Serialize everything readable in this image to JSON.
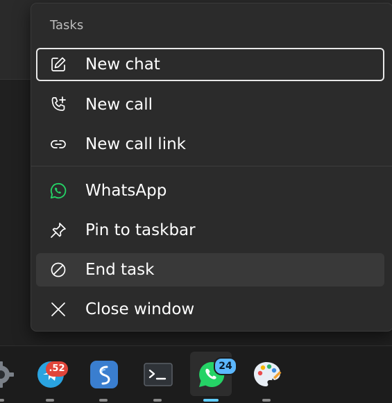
{
  "jump_list": {
    "header": "Tasks",
    "items": [
      {
        "label": "New chat",
        "icon": "compose-icon"
      },
      {
        "label": "New call",
        "icon": "phone-plus-icon"
      },
      {
        "label": "New call link",
        "icon": "link-icon"
      },
      {
        "label": "WhatsApp",
        "icon": "whatsapp-icon"
      },
      {
        "label": "Pin to taskbar",
        "icon": "pin-icon"
      },
      {
        "label": "End task",
        "icon": "end-task-icon"
      },
      {
        "label": "Close window",
        "icon": "close-icon"
      }
    ]
  },
  "taskbar": {
    "apps": [
      {
        "name": "Settings",
        "icon": "settings-gear-icon"
      },
      {
        "name": "Telegram",
        "icon": "telegram-icon",
        "badge": ".52"
      },
      {
        "name": "Simplenote",
        "icon": "simplenote-icon"
      },
      {
        "name": "Terminal",
        "icon": "terminal-icon"
      },
      {
        "name": "WhatsApp",
        "icon": "whatsapp-icon",
        "badge": "24",
        "active": true
      },
      {
        "name": "Paint",
        "icon": "palette-icon"
      }
    ]
  },
  "colors": {
    "menu_bg": "#2b2b2b",
    "whatsapp_green": "#25d366",
    "telegram_blue": "#2aa3e0",
    "badge_red": "#e0453a",
    "badge_blue": "#5bb7ff",
    "active_indicator": "#60cdff"
  }
}
